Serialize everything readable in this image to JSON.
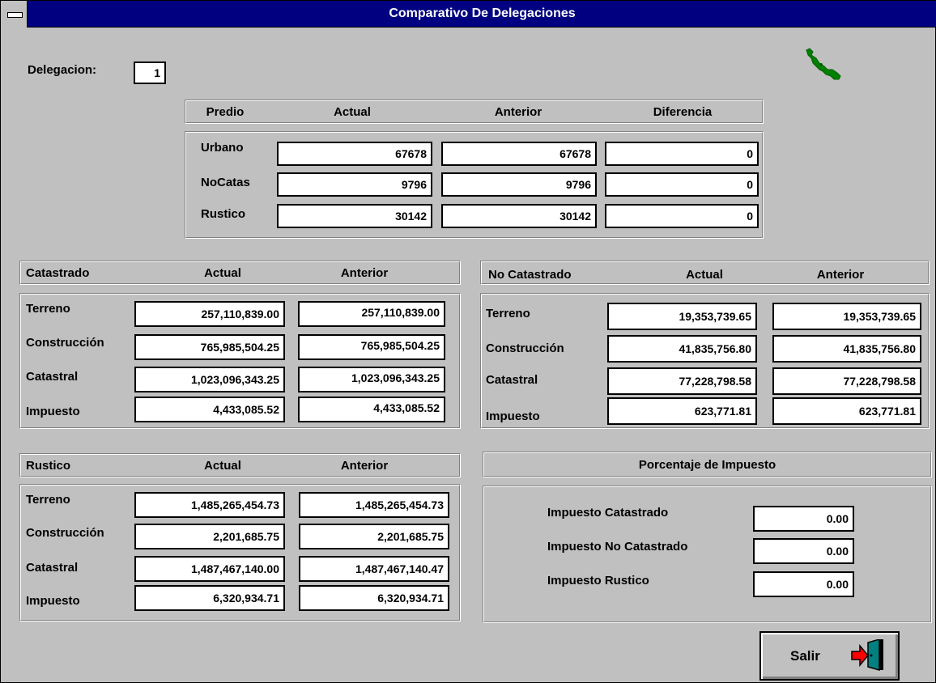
{
  "window": {
    "title": "Comparativo De Delegaciones"
  },
  "delegacion": {
    "label": "Delegacion:",
    "value": "1"
  },
  "predio": {
    "headers": [
      "Predio",
      "Actual",
      "Anterior",
      "Diferencia"
    ],
    "rows": [
      {
        "label": "Urbano",
        "actual": "67678",
        "anterior": "67678",
        "diferencia": "0"
      },
      {
        "label": "NoCatas",
        "actual": "9796",
        "anterior": "9796",
        "diferencia": "0"
      },
      {
        "label": "Rustico",
        "actual": "30142",
        "anterior": "30142",
        "diferencia": "0"
      }
    ]
  },
  "catastrado": {
    "headers": [
      "Catastrado",
      "Actual",
      "Anterior"
    ],
    "rows": [
      {
        "label": "Terreno",
        "actual": "257,110,839.00",
        "anterior": "257,110,839.00"
      },
      {
        "label": "Construcción",
        "actual": "765,985,504.25",
        "anterior": "765,985,504.25"
      },
      {
        "label": "Catastral",
        "actual": "1,023,096,343.25",
        "anterior": "1,023,096,343.25"
      },
      {
        "label": "Impuesto",
        "actual": "4,433,085.52",
        "anterior": "4,433,085.52"
      }
    ]
  },
  "no_catastrado": {
    "headers": [
      "No Catastrado",
      "Actual",
      "Anterior"
    ],
    "rows": [
      {
        "label": "Terreno",
        "actual": "19,353,739.65",
        "anterior": "19,353,739.65"
      },
      {
        "label": "Construcción",
        "actual": "41,835,756.80",
        "anterior": "41,835,756.80"
      },
      {
        "label": "Catastral",
        "actual": "77,228,798.58",
        "anterior": "77,228,798.58"
      },
      {
        "label": "Impuesto",
        "actual": "623,771.81",
        "anterior": "623,771.81"
      }
    ]
  },
  "rustico": {
    "headers": [
      "Rustico",
      "Actual",
      "Anterior"
    ],
    "rows": [
      {
        "label": "Terreno",
        "actual": "1,485,265,454.73",
        "anterior": "1,485,265,454.73"
      },
      {
        "label": "Construcción",
        "actual": "2,201,685.75",
        "anterior": "2,201,685.75"
      },
      {
        "label": "Catastral",
        "actual": "1,487,467,140.00",
        "anterior": "1,487,467,140.47"
      },
      {
        "label": "Impuesto",
        "actual": "6,320,934.71",
        "anterior": "6,320,934.71"
      }
    ]
  },
  "porcentaje": {
    "header": "Porcentaje de Impuesto",
    "rows": [
      {
        "label": "Impuesto Catastrado",
        "value": "0.00"
      },
      {
        "label": "Impuesto No Catastrado",
        "value": "0.00"
      },
      {
        "label": "Impuesto Rustico",
        "value": "0.00"
      }
    ]
  },
  "buttons": {
    "salir": "Salir"
  },
  "icons": {
    "map": "map-icon",
    "exit": "exit-door-icon",
    "system_menu": "system-menu-icon"
  },
  "colors": {
    "title_bar": "#000080",
    "background": "#c0c0c0",
    "map": "#008000",
    "door_arrow": "#ff0000",
    "door": "#008080"
  }
}
